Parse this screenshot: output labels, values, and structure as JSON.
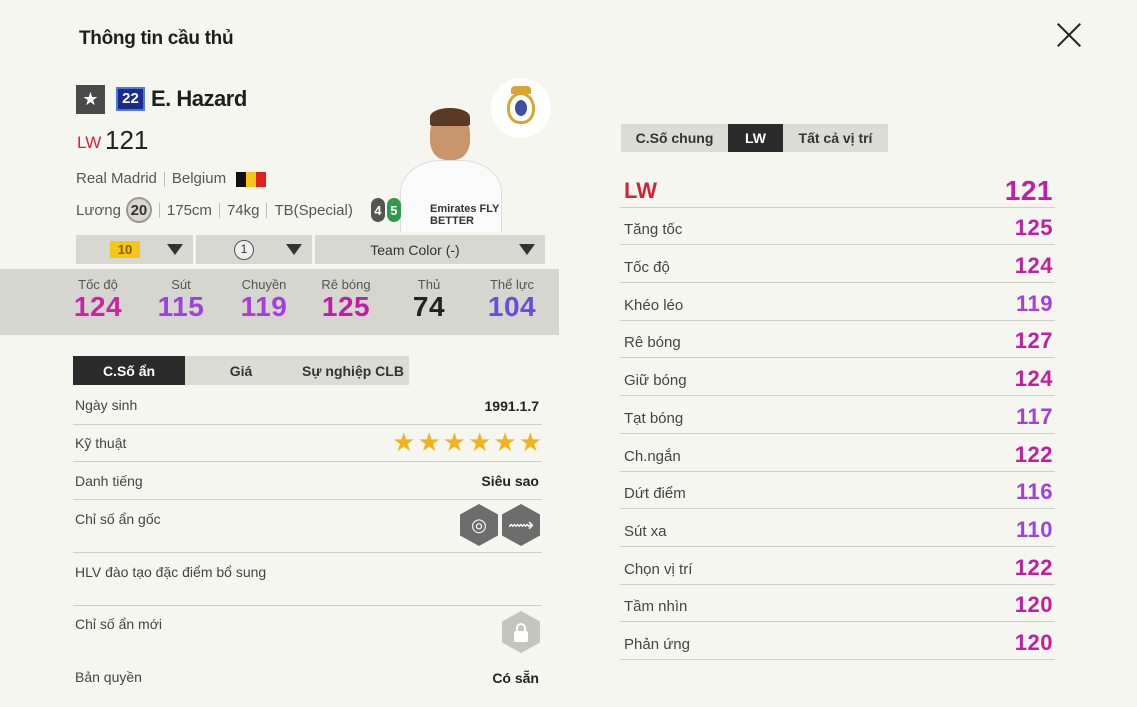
{
  "header": {
    "title": "Thông tin cầu thủ"
  },
  "player": {
    "name": "E. Hazard",
    "season_number": "22",
    "position": "LW",
    "overall": "121",
    "club": "Real Madrid",
    "nation": "Belgium",
    "salary_label": "Lương",
    "salary": "20",
    "height": "175cm",
    "weight": "74kg",
    "body_type": "TB(Special)",
    "weak_foot": "4",
    "skill_moves": "5",
    "sponsor_text": "Emirates FLY BETTER"
  },
  "controls": {
    "enhance_level": "10",
    "training_level": "1",
    "team_color": "Team Color (-)"
  },
  "summary_stats": [
    {
      "label": "Tốc độ",
      "value": "124",
      "color": "#cc22a6"
    },
    {
      "label": "Sút",
      "value": "115",
      "color": "#9a44dd"
    },
    {
      "label": "Chuyền",
      "value": "119",
      "color": "#a63fd8"
    },
    {
      "label": "Rê bóng",
      "value": "125",
      "color": "#c21ea4"
    },
    {
      "label": "Thủ",
      "value": "74",
      "color": "#222222"
    },
    {
      "label": "Thể lực",
      "value": "104",
      "color": "#6a4ce0"
    }
  ],
  "lower_tabs": [
    {
      "label": "C.Số ẩn",
      "active": true
    },
    {
      "label": "Giá",
      "active": false
    },
    {
      "label": "Sự nghiệp CLB",
      "active": false
    }
  ],
  "info": {
    "birthday_label": "Ngày sinh",
    "birthday": "1991.1.7",
    "skill_label": "Kỹ thuật",
    "skill_stars": 6,
    "fame_label": "Danh tiếng",
    "fame": "Siêu sao",
    "hidden_label": "Chỉ số ẩn gốc",
    "coach_label": "HLV đào tạo đặc điểm bổ sung",
    "new_hidden_label": "Chỉ số ẩn mới",
    "license_label": "Bản quyền",
    "license": "Có sẵn"
  },
  "right_tabs": [
    {
      "label": "C.Số chung",
      "active": false
    },
    {
      "label": "LW",
      "active": true
    },
    {
      "label": "Tất cả vị trí",
      "active": false
    }
  ],
  "detail": {
    "position": "LW",
    "overall": "121",
    "overall_color": "#c21ea4",
    "rows": [
      {
        "label": "Tăng tốc",
        "value": "125",
        "color": "#c21ea4"
      },
      {
        "label": "Tốc độ",
        "value": "124",
        "color": "#c21ea4"
      },
      {
        "label": "Khéo léo",
        "value": "119",
        "color": "#a63fd8"
      },
      {
        "label": "Rê bóng",
        "value": "127",
        "color": "#c21ea4"
      },
      {
        "label": "Giữ bóng",
        "value": "124",
        "color": "#c21ea4"
      },
      {
        "label": "Tạt bóng",
        "value": "117",
        "color": "#a63fd8"
      },
      {
        "label": "Ch.ngắn",
        "value": "122",
        "color": "#c21ea4"
      },
      {
        "label": "Dứt điểm",
        "value": "116",
        "color": "#a63fd8"
      },
      {
        "label": "Sút xa",
        "value": "110",
        "color": "#9a44dd"
      },
      {
        "label": "Chọn vị trí",
        "value": "122",
        "color": "#c21ea4"
      },
      {
        "label": "Tầm nhìn",
        "value": "120",
        "color": "#c21ea4"
      },
      {
        "label": "Phản ứng",
        "value": "120",
        "color": "#c21ea4"
      }
    ]
  }
}
